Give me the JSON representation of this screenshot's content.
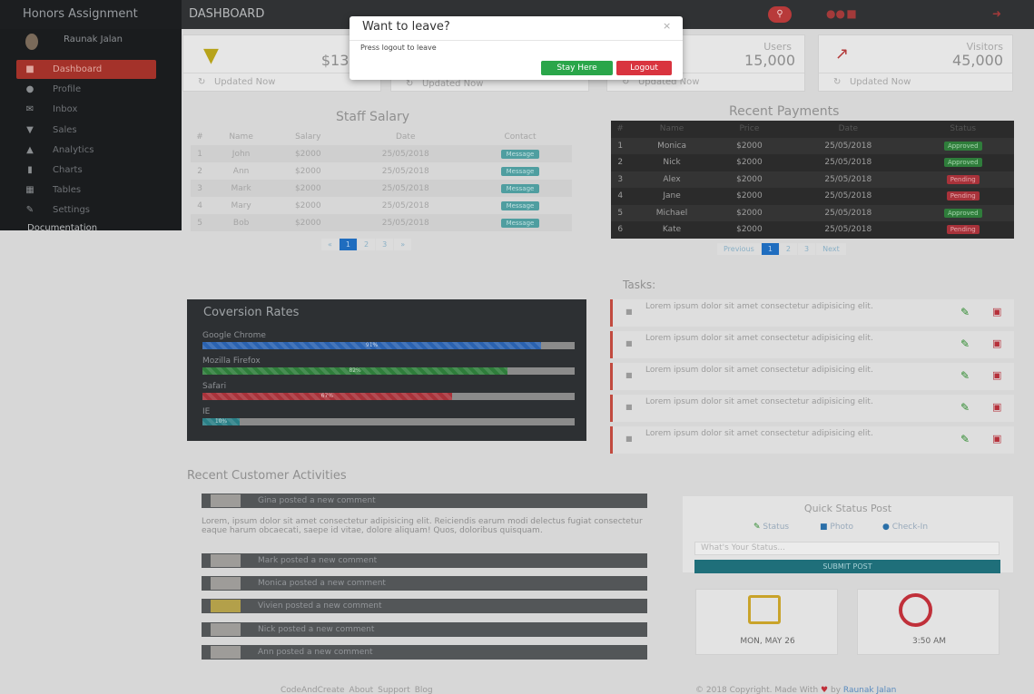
{
  "app": {
    "brand": "Honors Assignment",
    "nav_title": "DASHBOARD"
  },
  "sidebar": {
    "user_name": "Raunak Jalan",
    "items": [
      {
        "label": "Dashboard",
        "icon": "dashboard-icon",
        "active": true
      },
      {
        "label": "Profile",
        "icon": "user-icon"
      },
      {
        "label": "Inbox",
        "icon": "envelope-icon"
      },
      {
        "label": "Sales",
        "icon": "cart-icon"
      },
      {
        "label": "Analytics",
        "icon": "chart-area-icon"
      },
      {
        "label": "Charts",
        "icon": "bar-chart-icon"
      },
      {
        "label": "Tables",
        "icon": "table-icon"
      },
      {
        "label": "Settings",
        "icon": "wrench-icon"
      }
    ],
    "documentation": "Documentation"
  },
  "stats": {
    "sales": {
      "label": "Sa",
      "value": "$135,00",
      "updated": "Updated Now"
    },
    "card2": {
      "updated": "Updated Now"
    },
    "users": {
      "label": "Users",
      "value": "15,000",
      "updated": "Updated Now"
    },
    "visitors": {
      "label": "Visitors",
      "value": "45,000",
      "updated": "Updated Now"
    }
  },
  "modal": {
    "title": "Want to leave?",
    "close": "×",
    "body": "Press logout to leave",
    "stay_label": "Stay Here",
    "logout_label": "Logout"
  },
  "staff": {
    "title": "Staff Salary",
    "headers": [
      "#",
      "Name",
      "Salary",
      "Date",
      "Contact"
    ],
    "rows": [
      [
        "1",
        "John",
        "$2000",
        "25/05/2018",
        "Message"
      ],
      [
        "2",
        "Ann",
        "$2000",
        "25/05/2018",
        "Message"
      ],
      [
        "3",
        "Mark",
        "$2000",
        "25/05/2018",
        "Message"
      ],
      [
        "4",
        "Mary",
        "$2000",
        "25/05/2018",
        "Message"
      ],
      [
        "5",
        "Bob",
        "$2000",
        "25/05/2018",
        "Message"
      ]
    ],
    "pager": [
      "«",
      "1",
      "2",
      "3",
      "»"
    ]
  },
  "payments": {
    "title": "Recent Payments",
    "headers": [
      "#",
      "Name",
      "Price",
      "Date",
      "Status"
    ],
    "rows": [
      [
        "1",
        "Monica",
        "$2000",
        "25/05/2018",
        "Approved"
      ],
      [
        "2",
        "Nick",
        "$2000",
        "25/05/2018",
        "Approved"
      ],
      [
        "3",
        "Alex",
        "$2000",
        "25/05/2018",
        "Pending"
      ],
      [
        "4",
        "Jane",
        "$2000",
        "25/05/2018",
        "Pending"
      ],
      [
        "5",
        "Michael",
        "$2000",
        "25/05/2018",
        "Approved"
      ],
      [
        "6",
        "Kate",
        "$2000",
        "25/05/2018",
        "Pending"
      ]
    ],
    "pager": [
      "Previous",
      "1",
      "2",
      "3",
      "Next"
    ]
  },
  "conversion": {
    "title": "Coversion Rates",
    "bars": [
      {
        "label": "Google Chrome",
        "percent": 91,
        "text": "91%",
        "color": "#2a62b0"
      },
      {
        "label": "Mozilla Firefox",
        "percent": 82,
        "text": "82%",
        "color": "#2f7d3b"
      },
      {
        "label": "Safari",
        "percent": 67,
        "text": "67%",
        "color": "#a8323a"
      },
      {
        "label": "IE",
        "percent": 10,
        "text": "10%",
        "color": "#2a7f86"
      }
    ]
  },
  "tasks": {
    "title": "Tasks:",
    "items": [
      "Lorem ipsum dolor sit amet consectetur adipisicing elit.",
      "Lorem ipsum dolor sit amet consectetur adipisicing elit.",
      "Lorem ipsum dolor sit amet consectetur adipisicing elit.",
      "Lorem ipsum dolor sit amet consectetur adipisicing elit.",
      "Lorem ipsum dolor sit amet consectetur adipisicing elit."
    ]
  },
  "activities": {
    "title": "Recent Customer Activities",
    "first": "Gina posted a new comment",
    "paragraph": "Lorem, ipsum dolor sit amet consectetur adipisicing elit. Reiciendis earum modi delectus fugiat consectetur eaque harum obcaecati, saepe id vitae, dolore aliquam! Quos, doloribus quisquam.",
    "items": [
      "Mark posted a new comment",
      "Monica posted a new comment",
      "Vivien posted a new comment",
      "Nick posted a new comment",
      "Ann posted a new comment"
    ]
  },
  "quick_status": {
    "title": "Quick Status Post",
    "options": [
      "Status",
      "Photo",
      "Check-In"
    ],
    "placeholder": "What's Your Status...",
    "submit": "SUBMIT POST",
    "date": "MON, MAY 26",
    "time": "3:50 AM"
  },
  "footer": {
    "links": [
      "CodeAndCreate",
      "About",
      "Support",
      "Blog"
    ],
    "copyright_prefix": "© 2018 Copyright. Made With",
    "by": "by",
    "author": "Raunak Jalan"
  }
}
